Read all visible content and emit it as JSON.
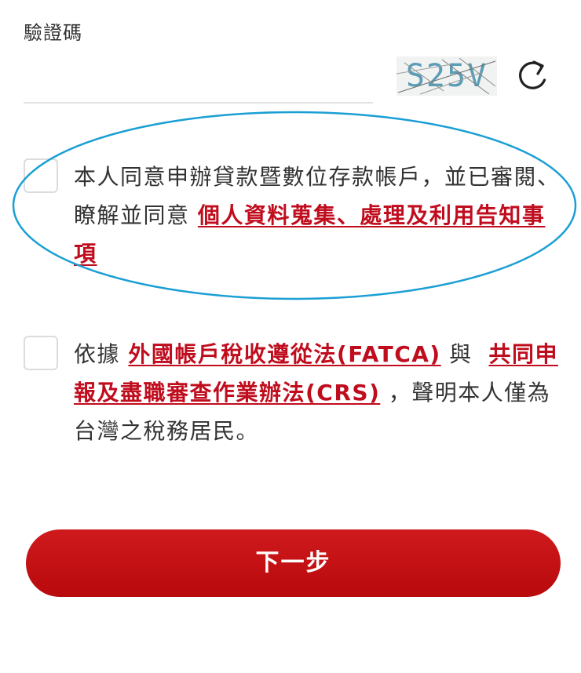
{
  "captcha": {
    "label": "驗證碼",
    "input_value": "",
    "image_text": "S25V",
    "refresh_icon": "refresh-icon"
  },
  "consents": [
    {
      "checked": false,
      "text_before": "本人同意申辦貸款暨數位存款帳戶，並已審閱、瞭解並同意 ",
      "link1": "個人資料蒐集、處理及利用告知事項"
    },
    {
      "checked": false,
      "text_before": "依據 ",
      "link1": "外國帳戶稅收遵從法(FATCA)",
      "text_middle": " 與  ",
      "link2": "共同申報及盡職審查作業辦法(CRS)",
      "text_after": " ，聲明本人僅為台灣之稅務居民。"
    }
  ],
  "next_button": {
    "label": "下一步"
  },
  "colors": {
    "link": "#c00d1e",
    "button": "#c4111a",
    "highlight_ellipse": "#1a9fd4",
    "captcha_text": "#5a9db6"
  }
}
